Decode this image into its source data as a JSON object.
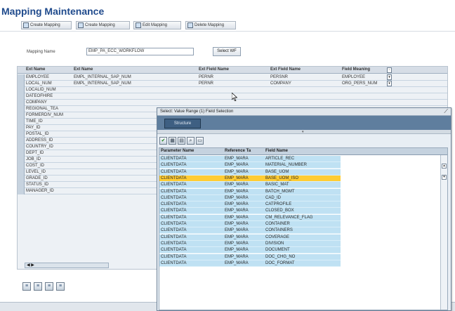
{
  "page": {
    "title": "Mapping Maintenance"
  },
  "toolbar": {
    "buttons": [
      {
        "label": "Create Mapping"
      },
      {
        "label": "Create Mapping"
      },
      {
        "label": "Edit Mapping"
      },
      {
        "label": "Delete Mapping"
      }
    ]
  },
  "form": {
    "label": "Mapping Name",
    "value": "EMP_PA_ECC_WORKFLOW",
    "select_button": "Select WF"
  },
  "grid": {
    "headers": [
      "Ext Name",
      "Ext Name",
      "Ext Field Name",
      "Ext Field Name",
      "Field Meaning"
    ],
    "rows": [
      {
        "c1": "EMPLOYEE",
        "c2": "EMPL_INTERNAL_SAP_NUM",
        "c3": "PERNR",
        "c4": "PERSNR",
        "c5": "EMPLOYEE"
      },
      {
        "c1": "LOCAL_NUM",
        "c2": "EMPL_INTERNAL_SAP_NUM",
        "c3": "PERNR",
        "c4": "COMPANY",
        "c5": "ORG_PERS_NUM"
      },
      {
        "c1": "LOCALID_NUM"
      },
      {
        "c1": "DATEOFHIRE"
      },
      {
        "c1": "COMPANY"
      },
      {
        "c1": "REGIONAL_TEA"
      },
      {
        "c1": "FORMERDIV_NUM"
      },
      {
        "c1": "TIME_ID"
      },
      {
        "c1": "PAY_ID"
      },
      {
        "c1": "POSTAL_ID"
      },
      {
        "c1": "ADDRESS_ID"
      },
      {
        "c1": "COUNTRY_ID"
      },
      {
        "c1": "DEPT_ID"
      },
      {
        "c1": "JOB_ID"
      },
      {
        "c1": "COST_ID"
      },
      {
        "c1": "LEVEL_ID"
      },
      {
        "c1": "GRADE_ID"
      },
      {
        "c1": "STATUS_ID"
      },
      {
        "c1": "MANAGER_ID"
      }
    ],
    "scroll_text": "◀ ▶"
  },
  "popup": {
    "title": "Select: Value Range (1) Field Selection",
    "tab": "Structure",
    "headers": [
      "Parameter Name",
      "Reference Ta",
      "Field Name"
    ],
    "rows": [
      {
        "p": "CLIENTDATA",
        "r": "EMP_MARA",
        "f": "ARTICLE_REC"
      },
      {
        "p": "CLIENTDATA",
        "r": "EMP_MARA",
        "f": "MATERIAL_NUMBER"
      },
      {
        "p": "CLIENTDATA",
        "r": "EMP_MARA",
        "f": "BASE_UOM"
      },
      {
        "p": "CLIENTDATA",
        "r": "EMP_MARA",
        "f": "BASE_UOM_ISO",
        "highlight": true
      },
      {
        "p": "CLIENTDATA",
        "r": "EMP_MARA",
        "f": "BASIC_MAT"
      },
      {
        "p": "CLIENTDATA",
        "r": "EMP_MARA",
        "f": "BATCH_MGMT"
      },
      {
        "p": "CLIENTDATA",
        "r": "EMP_MARA",
        "f": "CAD_ID"
      },
      {
        "p": "CLIENTDATA",
        "r": "EMP_MARA",
        "f": "CATPROFILE"
      },
      {
        "p": "CLIENTDATA",
        "r": "EMP_MARA",
        "f": "CLOSED_BOX"
      },
      {
        "p": "CLIENTDATA",
        "r": "EMP_MARA",
        "f": "CM_RELEVANCE_FLAG"
      },
      {
        "p": "CLIENTDATA",
        "r": "EMP_MARA",
        "f": "CONTAINER"
      },
      {
        "p": "CLIENTDATA",
        "r": "EMP_MARA",
        "f": "CONTAINERS"
      },
      {
        "p": "CLIENTDATA",
        "r": "EMP_MARA",
        "f": "COVERAGE"
      },
      {
        "p": "CLIENTDATA",
        "r": "EMP_MARA",
        "f": "DIVISION"
      },
      {
        "p": "CLIENTDATA",
        "r": "EMP_MARA",
        "f": "DOCUMENT"
      },
      {
        "p": "CLIENTDATA",
        "r": "EMP_MARA",
        "f": "DOC_CHG_NO"
      },
      {
        "p": "CLIENTDATA",
        "r": "EMP_MARA",
        "f": "DOC_FORMAT"
      }
    ]
  }
}
